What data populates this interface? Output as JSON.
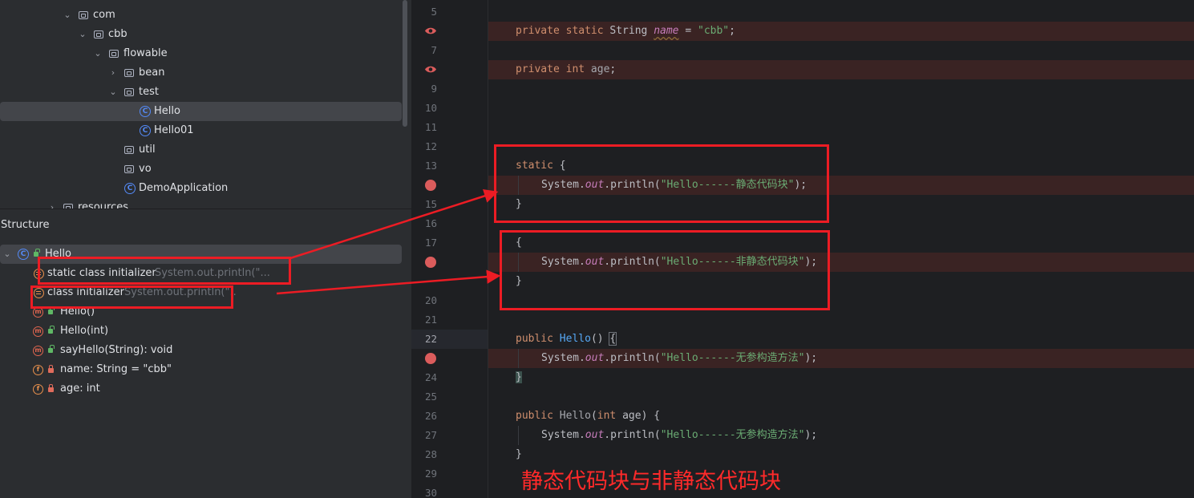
{
  "project_tree": {
    "rows": [
      {
        "label": "com"
      },
      {
        "label": "cbb"
      },
      {
        "label": "flowable"
      },
      {
        "label": "bean"
      },
      {
        "label": "test"
      },
      {
        "label": "Hello"
      },
      {
        "label": "Hello01"
      },
      {
        "label": "util"
      },
      {
        "label": "vo"
      },
      {
        "label": "DemoApplication"
      },
      {
        "label": "resources"
      }
    ],
    "class_icon_letter": "C"
  },
  "structure": {
    "title": "Structure",
    "root": {
      "label": "Hello",
      "icon": "class-icon"
    },
    "items": [
      {
        "label": "static class initializer",
        "hint": "System.out.println(\"...",
        "icon": "initializer-icon"
      },
      {
        "label": "class initializer",
        "hint": "System.out.println(\"..",
        "icon": "initializer-icon"
      },
      {
        "label": "Hello()",
        "hint": "",
        "icon": "method-icon",
        "letter": "m"
      },
      {
        "label": "Hello(int)",
        "hint": "",
        "icon": "method-icon",
        "letter": "m"
      },
      {
        "label": "sayHello(String): void",
        "hint": "",
        "icon": "method-icon",
        "letter": "m"
      },
      {
        "label": "name: String = \"cbb\"",
        "hint": "",
        "icon": "field-icon",
        "letter": "f"
      },
      {
        "label": "age: int",
        "hint": "",
        "icon": "field-icon",
        "letter": "f"
      }
    ]
  },
  "editor": {
    "line_numbers": [
      "5",
      "",
      "7",
      "",
      "9",
      "10",
      "11",
      "12",
      "13",
      "",
      "15",
      "16",
      "17",
      "",
      "",
      "20",
      "21",
      "22",
      "",
      "24",
      "25",
      "26",
      "27",
      "28",
      "29",
      "30"
    ],
    "current_line": "22",
    "code": {
      "l6_a": "private static ",
      "l6_b": "String ",
      "l6_c": "name",
      "l6_d": " = ",
      "l6_e": "\"cbb\"",
      "l6_f": ";",
      "l8_a": "private int ",
      "l8_b": "age",
      "l8_c": ";",
      "l13_a": "static",
      "l13_b": " {",
      "l14_a": "System.",
      "l14_b": "out",
      "l14_c": ".println(",
      "l14_d": "\"Hello------静态代码块\"",
      "l14_e": ");",
      "l15": "}",
      "l17": "{",
      "l18_a": "System.",
      "l18_b": "out",
      "l18_c": ".println(",
      "l18_d": "\"Hello------非静态代码块\"",
      "l18_e": ");",
      "l19": "}",
      "l22_a": "public ",
      "l22_b": "Hello",
      "l22_c": "() ",
      "l22_d": "{",
      "l23_a": "System.",
      "l23_b": "out",
      "l23_c": ".println(",
      "l23_d": "\"Hello------无参构造方法\"",
      "l23_e": ");",
      "l24": "}",
      "l26_a": "public ",
      "l26_b": "Hello",
      "l26_c": "(",
      "l26_d": "int ",
      "l26_e": "age",
      "l26_f": ") {",
      "l27_a": "System.",
      "l27_b": "out",
      "l27_c": ".println(",
      "l27_d": "\"Hello------无参构造方法\"",
      "l27_e": ");",
      "l28": "}"
    }
  },
  "annotation": {
    "caption": "静态代码块与非静态代码块",
    "color": "#ec1c24"
  },
  "colors": {
    "keyword": "#cf8e6d",
    "string": "#6aab73",
    "field": "#c77dbb",
    "method": "#56a8f5",
    "breakpoint": "#db5c5c",
    "editor_bg": "#1e1f22",
    "panel_bg": "#2b2d30"
  }
}
